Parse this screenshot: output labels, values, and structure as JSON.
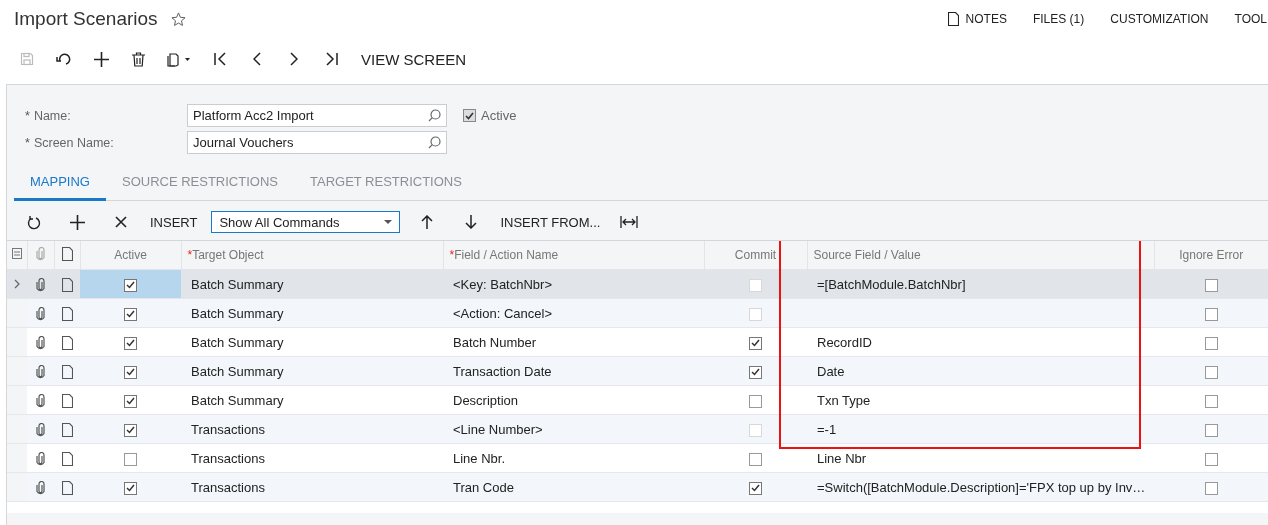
{
  "page": {
    "title": "Import Scenarios"
  },
  "top_links": [
    {
      "kind": "notes",
      "label": "NOTES"
    },
    {
      "kind": "plain",
      "label": "FILES (1)"
    },
    {
      "kind": "plain",
      "label": "CUSTOMIZATION"
    },
    {
      "kind": "plain",
      "label": "TOOL"
    }
  ],
  "toolbar": [
    {
      "kind": "save",
      "disabled": true
    },
    {
      "kind": "undo",
      "disabled": false
    },
    {
      "kind": "add",
      "disabled": false
    },
    {
      "kind": "delete",
      "disabled": false
    },
    {
      "kind": "clipboard",
      "disabled": false
    },
    {
      "kind": "first",
      "disabled": false
    },
    {
      "kind": "prev",
      "disabled": false
    },
    {
      "kind": "next",
      "disabled": false
    },
    {
      "kind": "last",
      "disabled": false
    },
    {
      "kind": "text",
      "label": "VIEW SCREEN",
      "disabled": false
    }
  ],
  "form": {
    "name": {
      "label": "Name:",
      "value": "Platform Acc2 Import",
      "required_mark": "*"
    },
    "screen_name": {
      "label": "Screen Name:",
      "value": "Journal Vouchers",
      "required_mark": "*"
    },
    "active": {
      "label": "Active",
      "checked": true
    }
  },
  "tabs": [
    {
      "label": "MAPPING",
      "selected": true
    },
    {
      "label": "SOURCE RESTRICTIONS",
      "selected": false
    },
    {
      "label": "TARGET RESTRICTIONS",
      "selected": false
    }
  ],
  "grid_toolbar": [
    {
      "kind": "refresh"
    },
    {
      "kind": "add"
    },
    {
      "kind": "delete"
    },
    {
      "kind": "text",
      "label": "INSERT"
    },
    {
      "kind": "select",
      "value": "Show All Commands"
    },
    {
      "kind": "up"
    },
    {
      "kind": "down"
    },
    {
      "kind": "text",
      "label": "INSERT FROM..."
    },
    {
      "kind": "fit"
    }
  ],
  "columns": [
    {
      "label": "Active"
    },
    {
      "label": "Target Object",
      "required_mark": "*"
    },
    {
      "label": "Field / Action Name",
      "required_mark": "*"
    },
    {
      "label": "Commit"
    },
    {
      "label": "Source Field / Value"
    },
    {
      "label": "Ignore Error"
    }
  ],
  "rows": [
    {
      "selected": true,
      "active": true,
      "target_object": "Batch Summary",
      "field": "<Key: BatchNbr>",
      "commit": {
        "checked": false,
        "disabled": true
      },
      "source": "=[BatchModule.BatchNbr]",
      "ignore_error": false
    },
    {
      "selected": false,
      "active": true,
      "target_object": "Batch Summary",
      "field": "<Action: Cancel>",
      "commit": {
        "checked": false,
        "disabled": true
      },
      "ignore_error": false
    },
    {
      "selected": false,
      "active": true,
      "target_object": "Batch Summary",
      "field": "Batch Number",
      "commit": {
        "checked": true,
        "disabled": false
      },
      "source": "RecordID",
      "ignore_error": false
    },
    {
      "selected": false,
      "active": true,
      "target_object": "Batch Summary",
      "field": "Transaction Date",
      "commit": {
        "checked": true,
        "disabled": false
      },
      "source": "Date",
      "ignore_error": false
    },
    {
      "selected": false,
      "active": true,
      "target_object": "Batch Summary",
      "field": "Description",
      "commit": {
        "checked": false,
        "disabled": false
      },
      "source": "Txn Type",
      "ignore_error": false
    },
    {
      "selected": false,
      "active": true,
      "target_object": "Transactions",
      "field": "<Line Number>",
      "commit": {
        "checked": false,
        "disabled": true
      },
      "source": "=-1",
      "ignore_error": false
    },
    {
      "selected": false,
      "active": false,
      "target_object": "Transactions",
      "field": "Line Nbr.",
      "commit": {
        "checked": false,
        "disabled": false
      },
      "source": "Line Nbr",
      "ignore_error": false
    },
    {
      "selected": false,
      "active": true,
      "target_object": "Transactions",
      "field": "Tran Code",
      "commit": {
        "checked": true,
        "disabled": false
      },
      "source": "=Switch([BatchModule.Description]='FPX top up by Inv…",
      "ignore_error": false
    }
  ]
}
